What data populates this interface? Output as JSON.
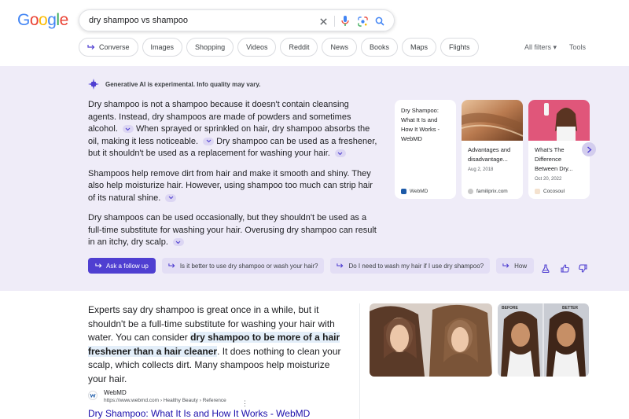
{
  "logo": {
    "letters": [
      "G",
      "o",
      "o",
      "g",
      "l",
      "e"
    ],
    "colors": [
      "#4285f4",
      "#ea4335",
      "#fbbc05",
      "#4285f4",
      "#34a853",
      "#ea4335"
    ]
  },
  "search": {
    "query": "dry shampoo vs shampoo"
  },
  "chips": [
    "Converse",
    "Images",
    "Shopping",
    "Videos",
    "Reddit",
    "News",
    "Books",
    "Maps",
    "Flights"
  ],
  "filters": {
    "all_filters": "All filters",
    "tools": "Tools"
  },
  "ai": {
    "notice": "Generative AI is experimental. Info quality may vary.",
    "p1": "Dry shampoo is not a shampoo because it doesn't contain cleansing agents. Instead, dry shampoos are made of powders and sometimes alcohol.",
    "p1b": "When sprayed or sprinkled on hair, dry shampoo absorbs the oil, making it less noticeable.",
    "p1c": "Dry shampoo can be used as a freshener, but it shouldn't be used as a replacement for washing your hair.",
    "p2": "Shampoos help remove dirt from hair and make it smooth and shiny. They also help moisturize hair. However, using shampoo too much can strip hair of its natural shine.",
    "p3": "Dry shampoos can be used occasionally, but they shouldn't be used as a full-time substitute for washing your hair. Overusing dry shampoo can result in an itchy, dry scalp.",
    "cards": [
      {
        "title": "Dry Shampoo: What It Is and How It Works - WebMD",
        "date": "",
        "source": "WebMD"
      },
      {
        "title": "Advantages and disadvantage...",
        "date": "Aug 2, 2018",
        "source": "familiprix.com"
      },
      {
        "title": "What's The Difference Between Dry...",
        "date": "Oct 20, 2022",
        "source": "Cocosoul"
      }
    ],
    "follow_up": "Ask a follow up",
    "suggestions": [
      "Is it better to use dry shampoo or wash your hair?",
      "Do I need to wash my hair if I use dry shampoo?",
      "How"
    ]
  },
  "snippet": {
    "text_before": "Experts say dry shampoo is great once in a while, but it shouldn't be a full-time substitute for washing your hair with water. You can consider ",
    "highlight": "dry shampoo to be more of a hair freshener than a hair cleaner",
    "text_after": ". It does nothing to clean your scalp, which collects dirt. Many shampoos help moisturize your hair.",
    "image_labels": {
      "before": "BEFORE",
      "after": "BETTER"
    },
    "source_name": "WebMD",
    "source_url": "https://www.webmd.com › Healthy Beauty › Reference",
    "title": "Dry Shampoo: What It Is and How It Works - WebMD"
  }
}
